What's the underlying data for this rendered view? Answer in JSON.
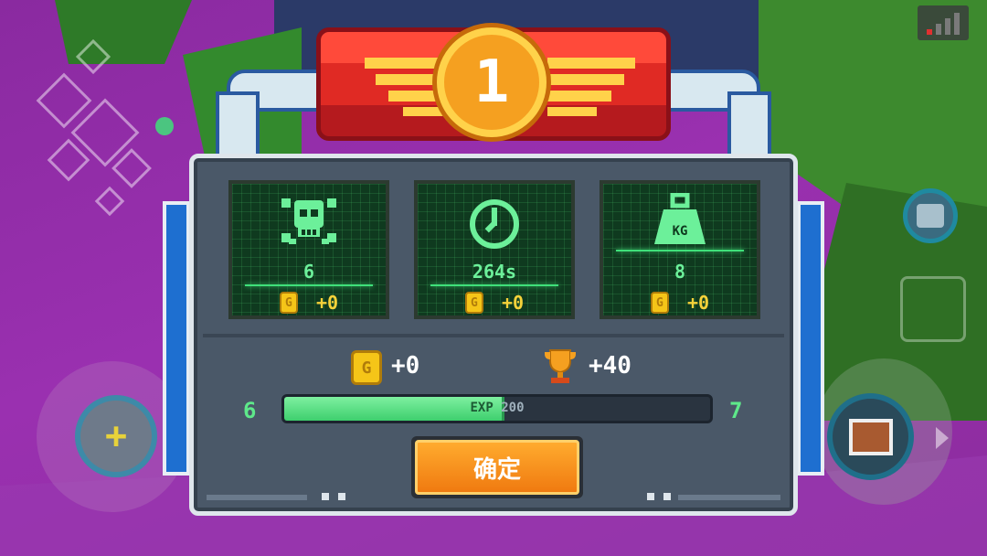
{
  "rank": "1",
  "stats": [
    {
      "icon": "skull-icon",
      "value": "6",
      "coin_reward": "+0"
    },
    {
      "icon": "clock-icon",
      "value": "264s",
      "coin_reward": "+0"
    },
    {
      "icon": "weight-icon",
      "icon_text": "KG",
      "value": "8",
      "coin_reward": "+0"
    }
  ],
  "totals": {
    "coins": "+0",
    "trophies": "+40"
  },
  "experience": {
    "current_level": "6",
    "next_level": "7",
    "label": "EXP",
    "amount": "200",
    "progress": 0.51
  },
  "confirm_label": "确定",
  "colors": {
    "accent_green": "#3fe07a",
    "button_orange": "#f58a1a",
    "banner_red": "#d8202a",
    "gold": "#f5c518"
  }
}
